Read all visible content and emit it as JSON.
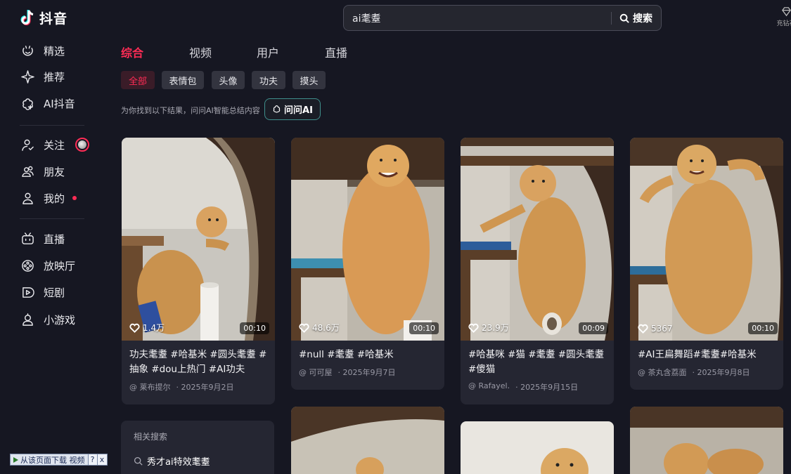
{
  "app": {
    "name": "抖音"
  },
  "sidebar": {
    "items": [
      {
        "label": "精选",
        "icon": "smile-face-icon"
      },
      {
        "label": "推荐",
        "icon": "sparkle-icon"
      },
      {
        "label": "AI抖音",
        "icon": "ai-flower-icon"
      },
      {
        "label": "关注",
        "icon": "user-check-icon"
      },
      {
        "label": "朋友",
        "icon": "friends-icon"
      },
      {
        "label": "我的",
        "icon": "user-icon"
      },
      {
        "label": "直播",
        "icon": "tv-icon"
      },
      {
        "label": "放映厅",
        "icon": "cinema-icon"
      },
      {
        "label": "短剧",
        "icon": "play-circle-icon"
      },
      {
        "label": "小游戏",
        "icon": "game-icon"
      }
    ]
  },
  "search": {
    "value": "ai耄耋",
    "button_label": "搜索"
  },
  "topright": {
    "label": "充钻石"
  },
  "tabs": [
    "综合",
    "视频",
    "用户",
    "直播"
  ],
  "chips": [
    "全部",
    "表情包",
    "头像",
    "功夫",
    "摸头"
  ],
  "hint": "为你找到以下结果，问问AI智能总结内容",
  "ask_ai": "问问AI",
  "cards": [
    {
      "likes": "1.4万",
      "duration": "00:10",
      "title": "功夫耄耋 #哈基米 #圆头耄耋 #抽象 #dou上热门 #AI功夫",
      "author": "@ 莱布提尔",
      "date": "· 2025年9月2日"
    },
    {
      "likes": "48.6万",
      "duration": "00:10",
      "title": "#null #耄耋 #哈基米",
      "author": "@ 可可屋",
      "date": "· 2025年9月7日"
    },
    {
      "likes": "23.9万",
      "duration": "00:09",
      "title": "#哈基咪 #猫 #耄耋 #圆头耄耋 #傻猫",
      "author": "@ Rafayel.",
      "date": "· 2025年9月15日"
    },
    {
      "likes": "5367",
      "duration": "00:10",
      "title": "#AI王扁舞蹈#耄耋#哈基米",
      "author": "@ 茶丸含荔面",
      "date": "· 2025年9月8日"
    }
  ],
  "related": {
    "title": "相关搜索",
    "items": [
      "秀才ai特效耄耋"
    ]
  },
  "download_bar": {
    "label": "从该页面下载 视频",
    "help": "?",
    "close": "x"
  },
  "colors": {
    "accent": "#fe2c55",
    "background": "#161722",
    "card": "#252632"
  }
}
